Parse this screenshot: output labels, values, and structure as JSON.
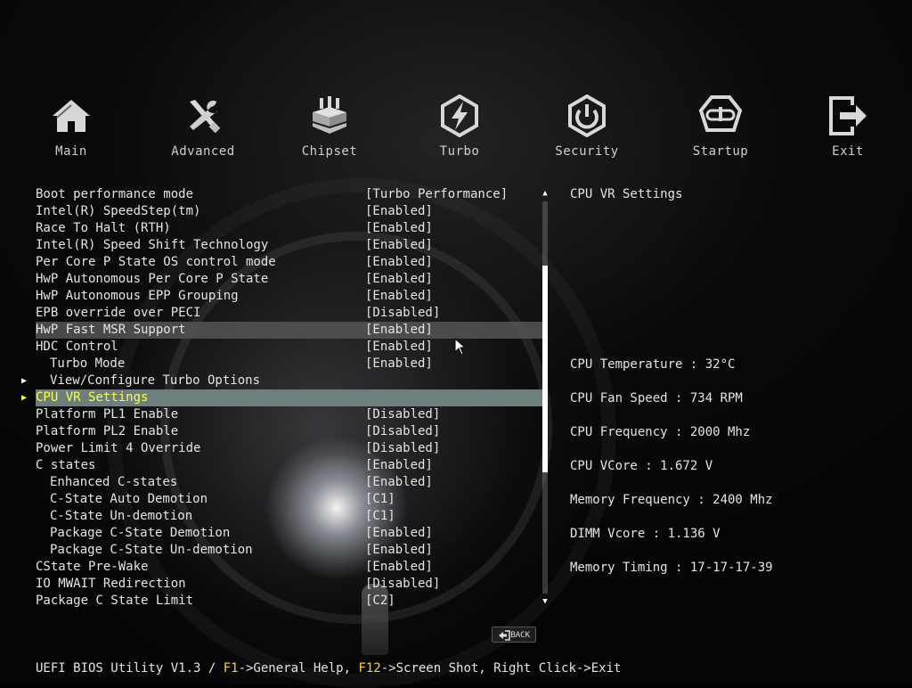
{
  "nav": [
    {
      "label": "Main",
      "icon": "home-icon"
    },
    {
      "label": "Advanced",
      "icon": "tools-icon"
    },
    {
      "label": "Chipset",
      "icon": "chipset-icon"
    },
    {
      "label": "Turbo",
      "icon": "lightning-icon"
    },
    {
      "label": "Security",
      "icon": "power-icon"
    },
    {
      "label": "Startup",
      "icon": "startup-icon"
    },
    {
      "label": "Exit",
      "icon": "exit-icon"
    }
  ],
  "settings": [
    {
      "label": "Boot performance mode",
      "value": "[Turbo Performance]"
    },
    {
      "label": "Intel(R) SpeedStep(tm)",
      "value": "[Enabled]"
    },
    {
      "label": "Race To Halt (RTH)",
      "value": "[Enabled]"
    },
    {
      "label": "Intel(R) Speed Shift Technology",
      "value": "[Enabled]"
    },
    {
      "label": "Per Core P State OS control mode",
      "value": "[Enabled]"
    },
    {
      "label": "HwP Autonomous Per Core P State",
      "value": "[Enabled]"
    },
    {
      "label": "HwP Autonomous EPP Grouping",
      "value": "[Enabled]"
    },
    {
      "label": "EPB override over PECI",
      "value": "[Disabled]"
    },
    {
      "label": "HwP Fast MSR Support",
      "value": "[Enabled]"
    },
    {
      "label": "HDC Control",
      "value": "[Enabled]"
    },
    {
      "label": "Turbo Mode",
      "value": "[Enabled]"
    },
    {
      "label": "View/Configure Turbo Options",
      "value": ""
    },
    {
      "label": "CPU VR Settings",
      "value": ""
    },
    {
      "label": "Platform PL1 Enable",
      "value": "[Disabled]"
    },
    {
      "label": "Platform PL2 Enable",
      "value": "[Disabled]"
    },
    {
      "label": "Power Limit 4 Override",
      "value": "[Disabled]"
    },
    {
      "label": "C states",
      "value": "[Enabled]"
    },
    {
      "label": "Enhanced C-states",
      "value": "[Enabled]"
    },
    {
      "label": "C-State Auto Demotion",
      "value": "[C1]"
    },
    {
      "label": "C-State Un-demotion",
      "value": "[C1]"
    },
    {
      "label": "Package C-State Demotion",
      "value": "[Enabled]"
    },
    {
      "label": "Package C-State Un-demotion",
      "value": "[Enabled]"
    },
    {
      "label": "CState Pre-Wake",
      "value": "[Enabled]"
    },
    {
      "label": "IO MWAIT Redirection",
      "value": "[Disabled]"
    },
    {
      "label": "Package C State Limit",
      "value": "[C2]"
    }
  ],
  "help": {
    "title": "CPU VR Settings"
  },
  "status": {
    "cpu_temp": "CPU Temperature : 32°C",
    "fan_speed": "CPU Fan Speed : 734 RPM",
    "cpu_freq": "CPU Frequency : 2000 Mhz",
    "cpu_vcore": "CPU VCore : 1.672 V",
    "mem_freq": "Memory Frequency : 2400 Mhz",
    "dimm_vcore": "DIMM Vcore : 1.136 V",
    "mem_timing": "Memory Timing : 17-17-17-39"
  },
  "back_label": "BACK",
  "footer": {
    "prefix": "UEFI BIOS Utility V1.3 / ",
    "key1": "F1",
    "text1": "->General Help, ",
    "key2": "F12",
    "text2": "->Screen Shot, Right Click->Exit"
  },
  "colors": {
    "accent": "#ffff3c",
    "selected_bg": "#6d7f7c",
    "hover_bg": "#555555",
    "key": "#ffd21e"
  }
}
